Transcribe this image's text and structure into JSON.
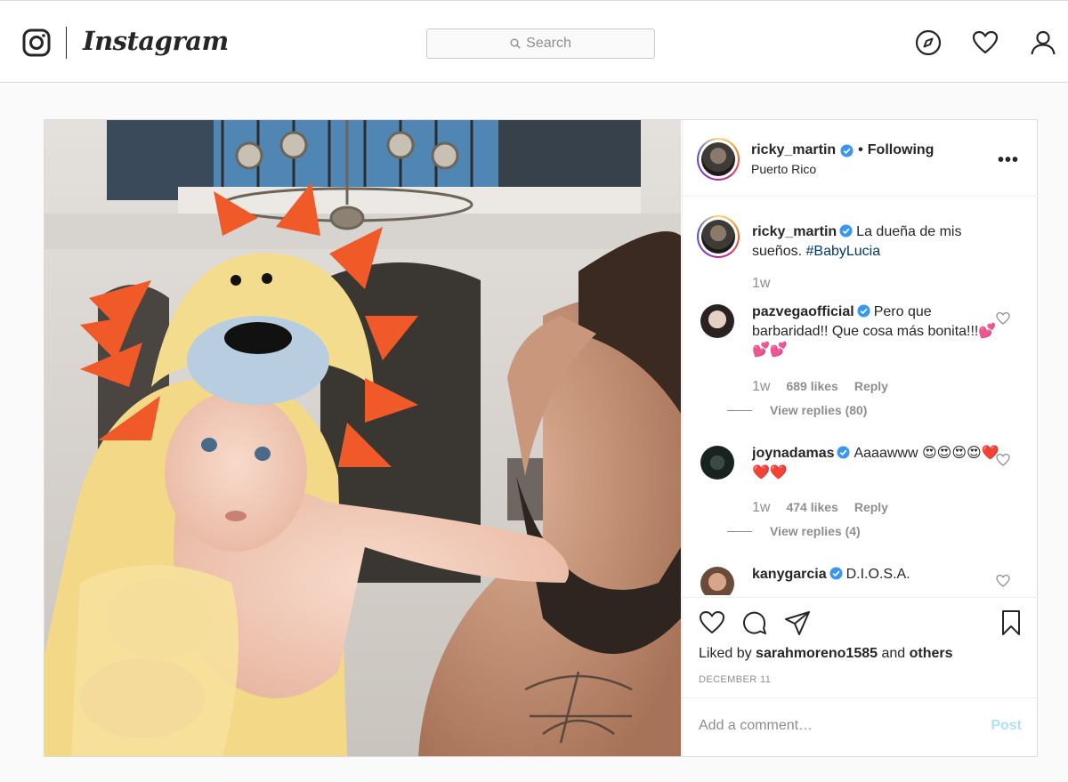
{
  "nav": {
    "brand": "Instagram",
    "search_placeholder": "Search",
    "icons": [
      "explore-icon",
      "activity-heart-icon",
      "profile-icon"
    ]
  },
  "post": {
    "author": "ricky_martin",
    "follow_status": "Following",
    "location": "Puerto Rico",
    "more_icon": "•••",
    "caption": {
      "user": "ricky_martin",
      "text": "La dueña de mis sueños.",
      "hashtag": "#BabyLucia",
      "time": "1w"
    },
    "comments": [
      {
        "user": "pazvegaofficial",
        "text": "Pero que barbaridad!! Que cosa más bonita!!!💕💕💕",
        "time": "1w",
        "likes": "689 likes",
        "reply": "Reply",
        "view_replies": "View replies (80)"
      },
      {
        "user": "joynadamas",
        "text": "Aaaawww 😍😍😍😍❤️❤️❤️",
        "time": "1w",
        "likes": "474 likes",
        "reply": "Reply",
        "view_replies": "View replies (4)"
      },
      {
        "user": "kanygarcia",
        "text": "D.I.O.S.A."
      }
    ],
    "liked_by_prefix": "Liked by",
    "liked_by_user": "sarahmoreno1585",
    "liked_by_and": "and",
    "liked_by_others": "others",
    "date": "DECEMBER 11",
    "add_comment_placeholder": "Add a comment…",
    "post_button": "Post"
  },
  "colors": {
    "link_blue": "#00376b",
    "post_button_disabled": "#b2dffc",
    "verified_blue": "#3897f0",
    "secondary_text": "#8e8e8e"
  }
}
